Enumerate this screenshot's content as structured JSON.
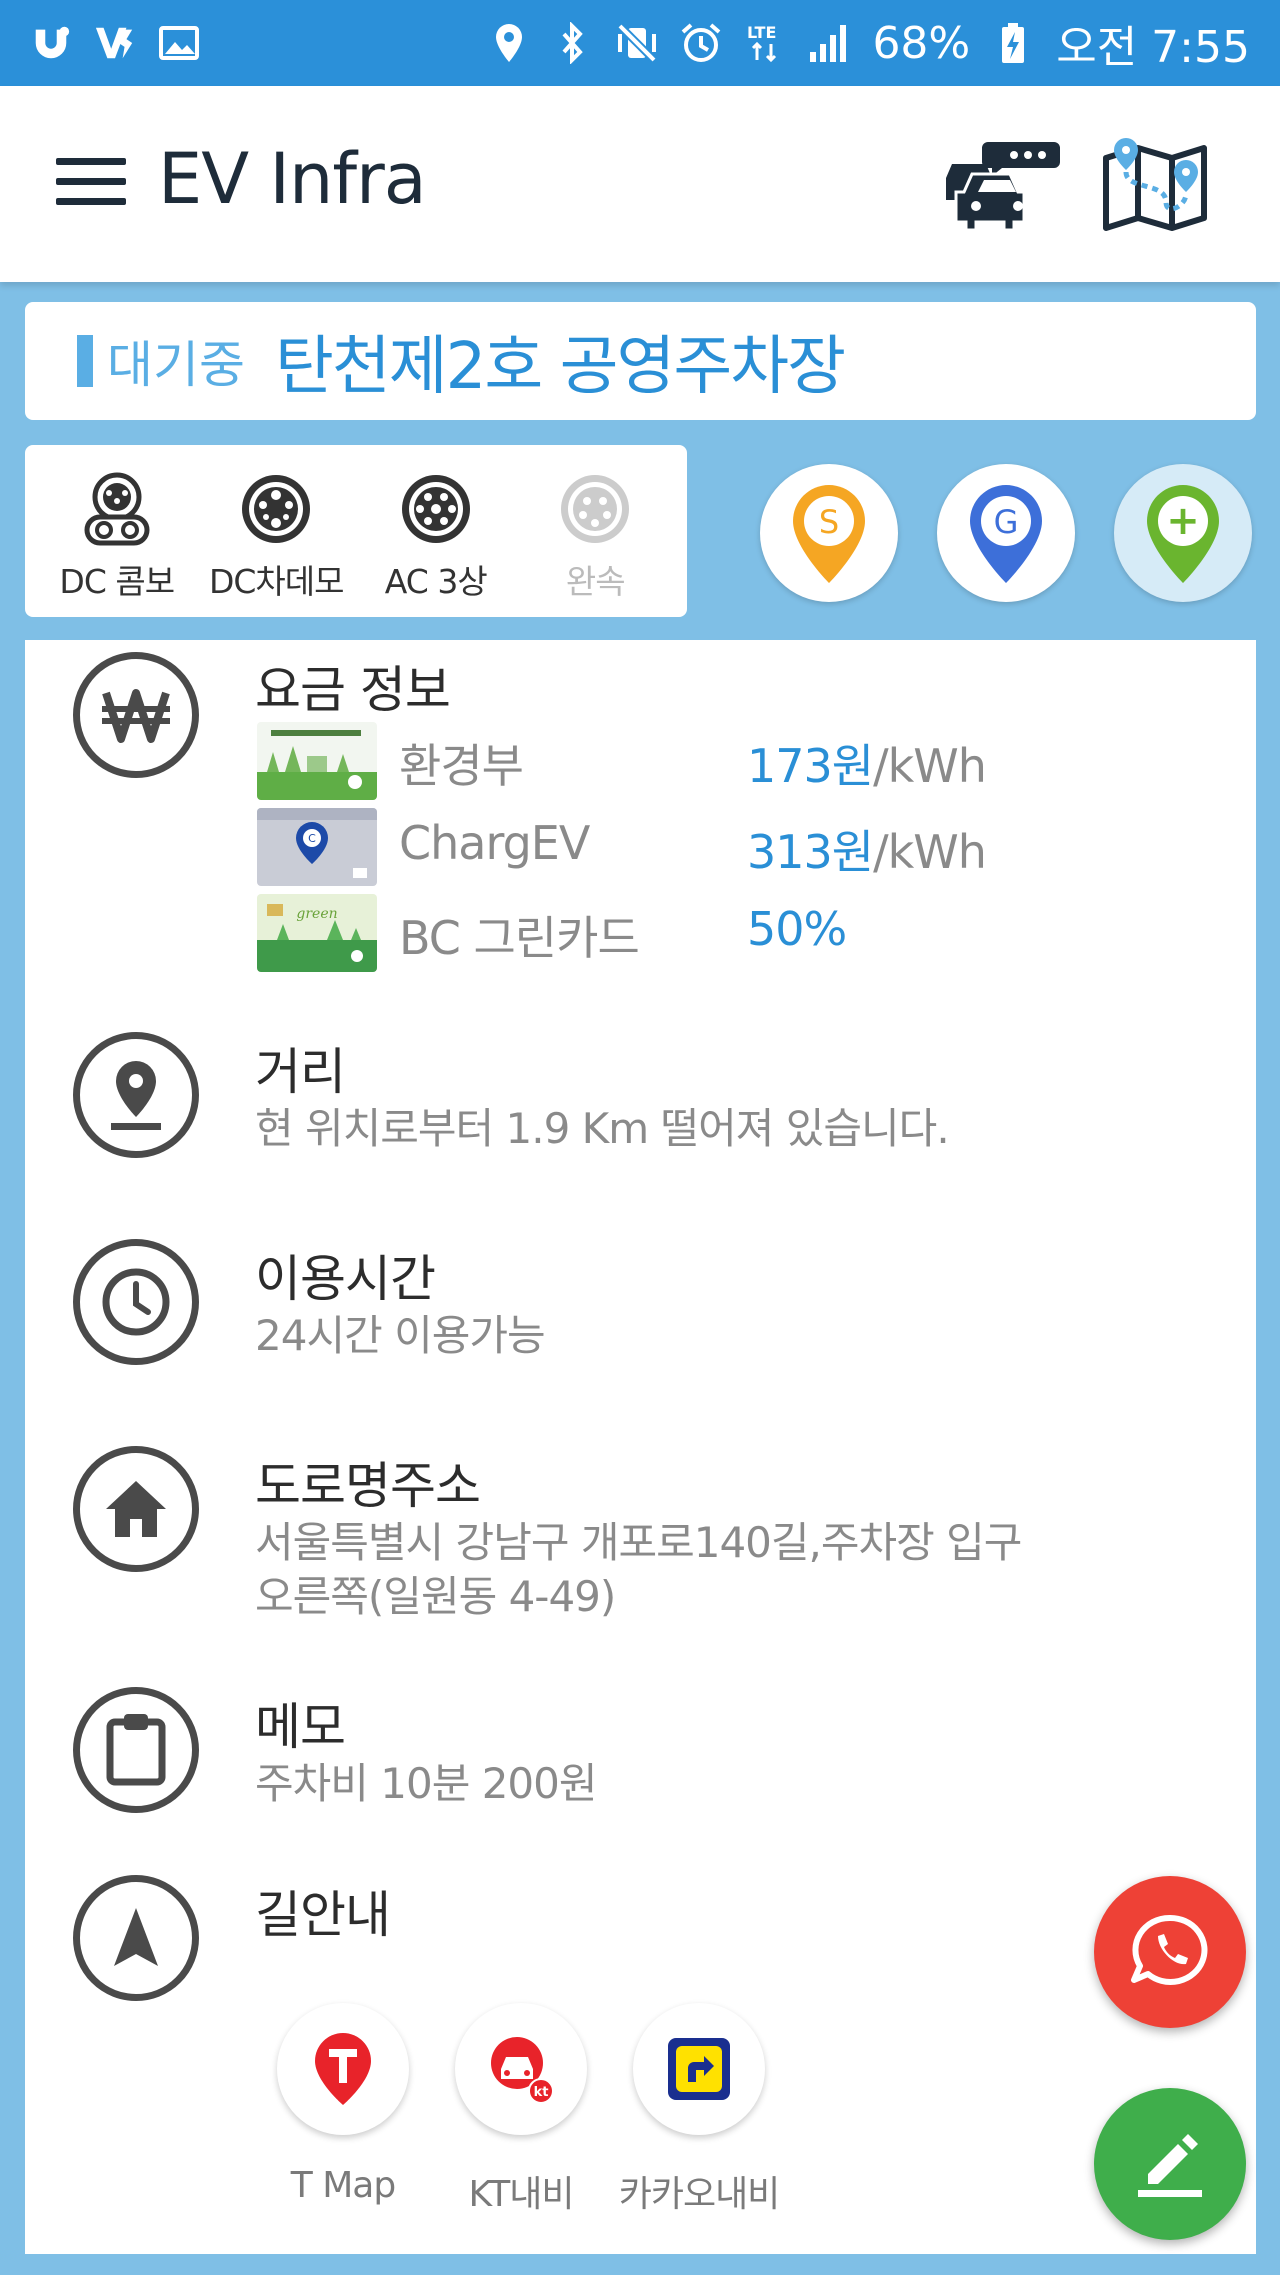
{
  "status_bar": {
    "battery": "68%",
    "network": "LTE",
    "time": "오전 7:55",
    "icons": [
      "u-plus-icon",
      "v3-icon",
      "gallery-icon",
      "location-icon",
      "bluetooth-icon",
      "mute-vibrate-icon",
      "alarm-icon",
      "lte-icon",
      "signal-icon",
      "battery-charging-icon"
    ]
  },
  "app_bar": {
    "title": "EV Infra",
    "icons": [
      "menu-icon",
      "traffic-icon",
      "route-map-icon"
    ]
  },
  "station": {
    "status": "대기중",
    "name": "탄천제2호 공영주차장",
    "status_color": "#5aaee4",
    "name_color": "#2a8fd6"
  },
  "connectors": [
    {
      "label": "DC 콤보",
      "available": true
    },
    {
      "label": "DC차데모",
      "available": true
    },
    {
      "label": "AC 3상",
      "available": true
    },
    {
      "label": "완속",
      "available": false
    }
  ],
  "pins": [
    {
      "letter": "S",
      "color": "#f5a623"
    },
    {
      "letter": "G",
      "color": "#3d6fd9"
    },
    {
      "letter": "+",
      "color": "#6ab52f"
    }
  ],
  "sections": {
    "fee": {
      "title": "요금 정보",
      "icon": "won-icon",
      "rows": [
        {
          "name": "환경부",
          "value": "173원",
          "unit": "/kWh"
        },
        {
          "name": "ChargEV",
          "value": "313원",
          "unit": "/kWh"
        },
        {
          "name": "BC 그린카드",
          "value": "50%",
          "unit": ""
        }
      ]
    },
    "distance": {
      "title": "거리",
      "text": "현 위치로부터 1.9 Km 떨어져 있습니다.",
      "icon": "location-pin-icon"
    },
    "hours": {
      "title": "이용시간",
      "text": "24시간 이용가능",
      "icon": "clock-icon"
    },
    "address": {
      "title": "도로명주소",
      "line1": "서울특별시 강남구 개포로140길,주차장 입구",
      "line2": "오른쪽(일원동 4-49)",
      "icon": "home-icon"
    },
    "memo": {
      "title": "메모",
      "text": "주차비 10분 200원",
      "icon": "clipboard-icon"
    },
    "navigation": {
      "title": "길안내",
      "icon": "navigation-arrow-icon",
      "apps": [
        {
          "label": "T Map"
        },
        {
          "label": "KT내비"
        },
        {
          "label": "카카오내비"
        }
      ]
    }
  },
  "fabs": {
    "call_color": "#ee4136",
    "edit_color": "#3fae4b"
  }
}
